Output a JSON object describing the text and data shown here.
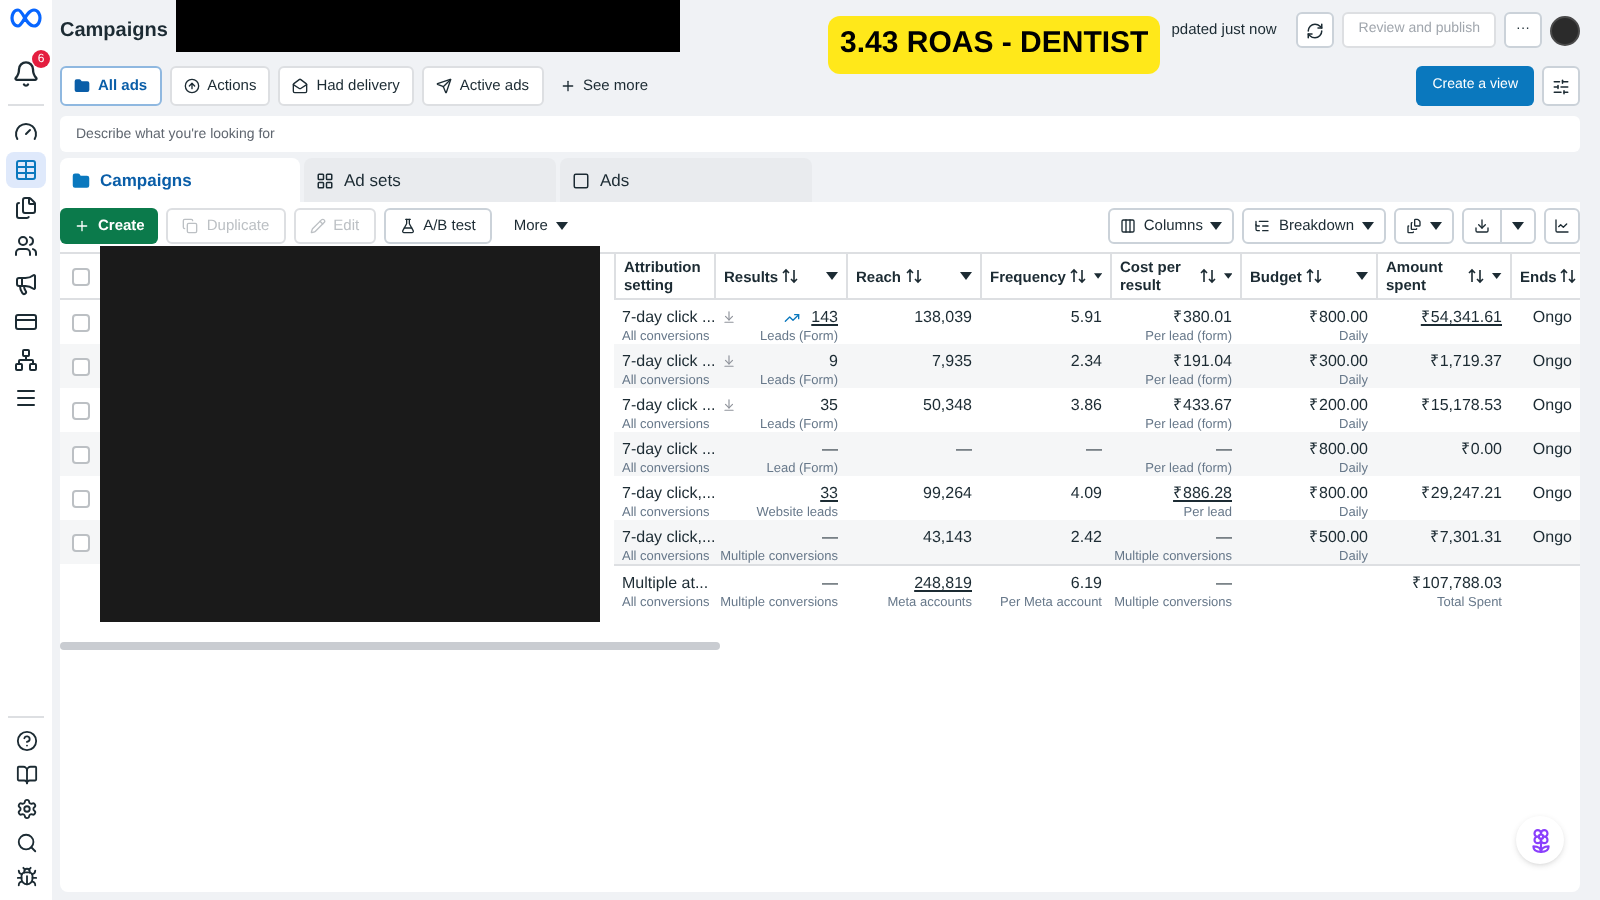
{
  "header": {
    "title": "Campaigns",
    "status": "pdated just now",
    "review_button": {
      "label": "Review and publish",
      "disabled": true
    },
    "more_button": "···"
  },
  "banner": "3.43 ROAS - DENTIST",
  "sidebar": {
    "notifications_badge": "6",
    "items": [
      {
        "selected": false
      },
      {
        "selected": true
      },
      {
        "selected": false
      },
      {
        "selected": false
      },
      {
        "selected": false
      },
      {
        "selected": false
      },
      {
        "selected": false
      },
      {
        "selected": false
      }
    ]
  },
  "filters": {
    "chips": [
      {
        "label": "All ads",
        "selected": true
      },
      {
        "label": "Actions",
        "selected": false
      },
      {
        "label": "Had delivery",
        "selected": false
      },
      {
        "label": "Active ads",
        "selected": false
      }
    ],
    "see_more": "See more",
    "create_view": "Create a view"
  },
  "search": {
    "placeholder": "Describe what you're looking for"
  },
  "tabs": [
    {
      "label": "Campaigns",
      "selected": true
    },
    {
      "label": "Ad sets",
      "selected": false
    },
    {
      "label": "Ads",
      "selected": false
    }
  ],
  "toolbar": {
    "buttons": [
      {
        "kind": "create",
        "label": "Create",
        "disabled": false
      },
      {
        "kind": "duplicate",
        "label": "Duplicate",
        "disabled": true
      },
      {
        "kind": "edit",
        "label": "Edit",
        "disabled": true
      },
      {
        "kind": "abtest",
        "label": "A/B test",
        "disabled": false
      },
      {
        "kind": "more",
        "label": "More",
        "disabled": false
      }
    ],
    "columns": "Columns",
    "breakdown": "Breakdown"
  },
  "table": {
    "header_checked": false,
    "columns": [
      "Attribution setting",
      "Results",
      "Reach",
      "Frequency",
      "Cost per result",
      "Budget",
      "Amount spent",
      "Ends"
    ],
    "rows": [
      {
        "checked": false,
        "attribution": "7-day click ...",
        "attribution_sub": "All conversions",
        "download": true,
        "trend": true,
        "results": "143",
        "results_linked": true,
        "results_sub": "Leads (Form)",
        "reach": "138,039",
        "frequency": "5.91",
        "cost": "₹380.01",
        "cost_linked": false,
        "cost_sub": "Per lead (form)",
        "budget": "₹800.00",
        "budget_sub": "Daily",
        "spent": "₹54,341.61",
        "spent_linked": true,
        "ends": "Ongo"
      },
      {
        "checked": false,
        "attribution": "7-day click ...",
        "attribution_sub": "All conversions",
        "download": true,
        "trend": false,
        "results": "9",
        "results_linked": false,
        "results_sub": "Leads (Form)",
        "reach": "7,935",
        "frequency": "2.34",
        "cost": "₹191.04",
        "cost_linked": false,
        "cost_sub": "Per lead (form)",
        "budget": "₹300.00",
        "budget_sub": "Daily",
        "spent": "₹1,719.37",
        "spent_linked": false,
        "ends": "Ongo"
      },
      {
        "checked": false,
        "attribution": "7-day click ...",
        "attribution_sub": "All conversions",
        "download": true,
        "trend": false,
        "results": "35",
        "results_linked": false,
        "results_sub": "Leads (Form)",
        "reach": "50,348",
        "frequency": "3.86",
        "cost": "₹433.67",
        "cost_linked": false,
        "cost_sub": "Per lead (form)",
        "budget": "₹200.00",
        "budget_sub": "Daily",
        "spent": "₹15,178.53",
        "spent_linked": false,
        "ends": "Ongo"
      },
      {
        "checked": false,
        "attribution": "7-day click ...",
        "attribution_sub": "All conversions",
        "download": false,
        "trend": false,
        "results": "—",
        "results_linked": false,
        "results_sub": "Lead (Form)",
        "reach": "—",
        "frequency": "—",
        "cost": "—",
        "cost_linked": false,
        "cost_sub": "Per lead (form)",
        "budget": "₹800.00",
        "budget_sub": "Daily",
        "spent": "₹0.00",
        "spent_linked": false,
        "ends": "Ongo"
      },
      {
        "checked": false,
        "attribution": "7-day click,...",
        "attribution_sub": "All conversions",
        "download": false,
        "trend": false,
        "results": "33",
        "results_linked": true,
        "results_sub": "Website leads",
        "reach": "99,264",
        "frequency": "4.09",
        "cost": "₹886.28",
        "cost_linked": true,
        "cost_sub": "Per lead",
        "budget": "₹800.00",
        "budget_sub": "Daily",
        "spent": "₹29,247.21",
        "spent_linked": false,
        "ends": "Ongo"
      },
      {
        "checked": false,
        "attribution": "7-day click,...",
        "attribution_sub": "All conversions",
        "download": false,
        "trend": false,
        "results": "—",
        "results_linked": false,
        "results_sub": "Multiple conversions",
        "reach": "43,143",
        "frequency": "2.42",
        "cost": "—",
        "cost_linked": false,
        "cost_sub": "Multiple conversions",
        "budget": "₹500.00",
        "budget_sub": "Daily",
        "spent": "₹7,301.31",
        "spent_linked": false,
        "ends": "Ongo"
      }
    ],
    "total": {
      "attribution": "Multiple at...",
      "attribution_sub": "All conversions",
      "results": "—",
      "results_sub": "Multiple conversions",
      "reach": "248,819",
      "reach_sub": "Meta accounts",
      "frequency": "6.19",
      "frequency_sub": "Per Meta account",
      "cost": "—",
      "cost_sub": "Multiple conversions",
      "spent": "₹107,788.03",
      "spent_sub": "Total Spent"
    }
  }
}
